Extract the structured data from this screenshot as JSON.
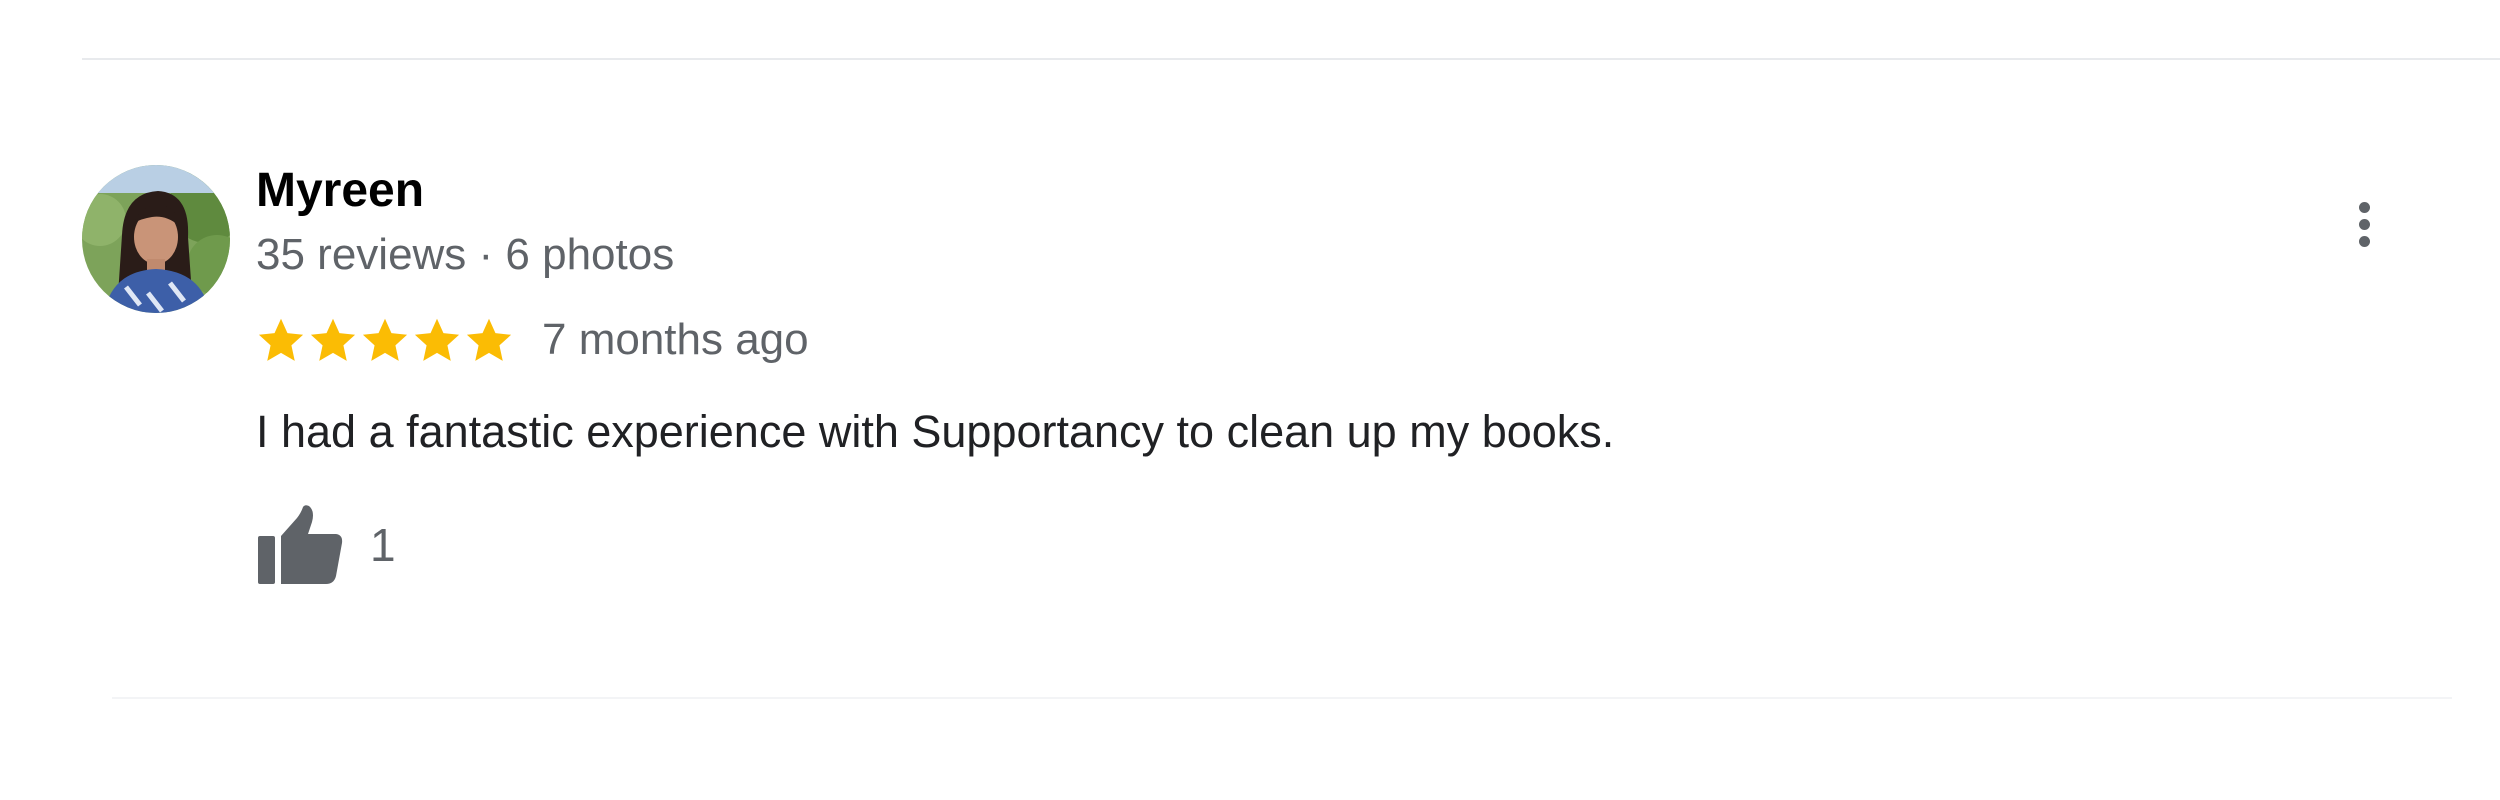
{
  "review": {
    "author_name": "Myreen",
    "author_meta": "35 reviews · 6 photos",
    "rating": 5,
    "rating_max": 5,
    "time_ago": "7 months ago",
    "text": "I had a fantastic experience with Supportancy to clean up my books.",
    "likes": "1"
  },
  "icons": {
    "star": "star-icon",
    "thumb": "thumbs-up-icon",
    "more": "more-vert-icon"
  },
  "colors": {
    "star": "#fbbc04",
    "secondary_text": "#5f6368",
    "primary_text": "#202124",
    "thumb": "#5f6368",
    "divider": "#e8eaed"
  }
}
